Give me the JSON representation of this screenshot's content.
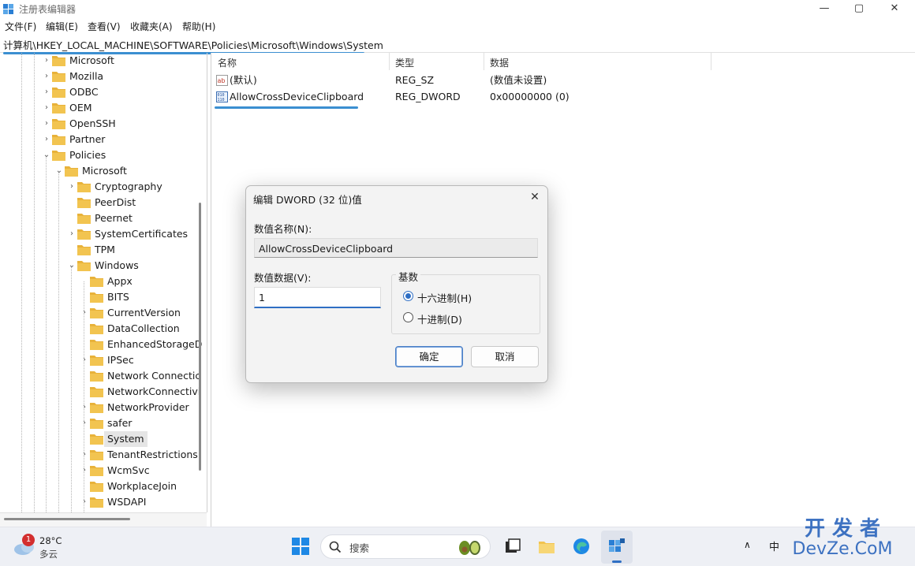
{
  "window": {
    "title": "注册表编辑器",
    "menu": [
      "文件(F)",
      "编辑(E)",
      "查看(V)",
      "收藏夹(A)",
      "帮助(H)"
    ]
  },
  "address_bar": {
    "path": "计算机\\HKEY_LOCAL_MACHINE\\SOFTWARE\\Policies\\Microsoft\\Windows\\System"
  },
  "tree": {
    "items": [
      {
        "label": "Microsoft",
        "chevron": "›"
      },
      {
        "label": "Mozilla",
        "chevron": "›"
      },
      {
        "label": "ODBC",
        "chevron": "›"
      },
      {
        "label": "OEM",
        "chevron": "›"
      },
      {
        "label": "OpenSSH",
        "chevron": "›"
      },
      {
        "label": "Partner",
        "chevron": "›"
      },
      {
        "label": "Policies",
        "chevron": "⌄"
      },
      {
        "label": "Microsoft",
        "chevron": "⌄"
      },
      {
        "label": "Cryptography",
        "chevron": "›"
      },
      {
        "label": "PeerDist",
        "chevron": ""
      },
      {
        "label": "Peernet",
        "chevron": ""
      },
      {
        "label": "SystemCertificates",
        "chevron": "›"
      },
      {
        "label": "TPM",
        "chevron": ""
      },
      {
        "label": "Windows",
        "chevron": "⌄"
      },
      {
        "label": "Appx",
        "chevron": ""
      },
      {
        "label": "BITS",
        "chevron": ""
      },
      {
        "label": "CurrentVersion",
        "chevron": "›"
      },
      {
        "label": "DataCollection",
        "chevron": ""
      },
      {
        "label": "EnhancedStorageD",
        "chevron": ""
      },
      {
        "label": "IPSec",
        "chevron": "›"
      },
      {
        "label": "Network Connectic",
        "chevron": ""
      },
      {
        "label": "NetworkConnectivi",
        "chevron": ""
      },
      {
        "label": "NetworkProvider",
        "chevron": "›"
      },
      {
        "label": "safer",
        "chevron": "›"
      },
      {
        "label": "System",
        "chevron": ""
      },
      {
        "label": "TenantRestrictions",
        "chevron": "›"
      },
      {
        "label": "WcmSvc",
        "chevron": "›"
      },
      {
        "label": "WorkplaceJoin",
        "chevron": ""
      },
      {
        "label": "WSDAPI",
        "chevron": "›"
      }
    ],
    "selected": "System"
  },
  "list": {
    "columns": [
      "名称",
      "类型",
      "数据"
    ],
    "rows": [
      {
        "name": "(默认)",
        "type": "REG_SZ",
        "data": "(数值未设置)",
        "icon": "string-value-icon"
      },
      {
        "name": "AllowCrossDeviceClipboard",
        "type": "REG_DWORD",
        "data": "0x00000000 (0)",
        "icon": "dword-value-icon"
      }
    ]
  },
  "dialog": {
    "title": "编辑 DWORD (32 位)值",
    "name_label": "数值名称(N):",
    "name_value": "AllowCrossDeviceClipboard",
    "data_label": "数值数据(V):",
    "data_value": "1",
    "base_label": "基数",
    "hex_label": "十六进制(H)",
    "dec_label": "十进制(D)",
    "selected_base": "hex",
    "ok": "确定",
    "cancel": "取消"
  },
  "taskbar": {
    "weather_temp": "28°C",
    "weather_desc": "多云",
    "weather_badge": "1",
    "search_placeholder": "搜索",
    "ime": "中",
    "tray_chevron": "∧"
  },
  "watermark": {
    "line1": "开 发 者",
    "line2": "DevZe.CoM"
  },
  "colors": {
    "accent": "#2f6fc4",
    "highlight_underline": "#3b8fd1",
    "folder": "#f2c450"
  }
}
